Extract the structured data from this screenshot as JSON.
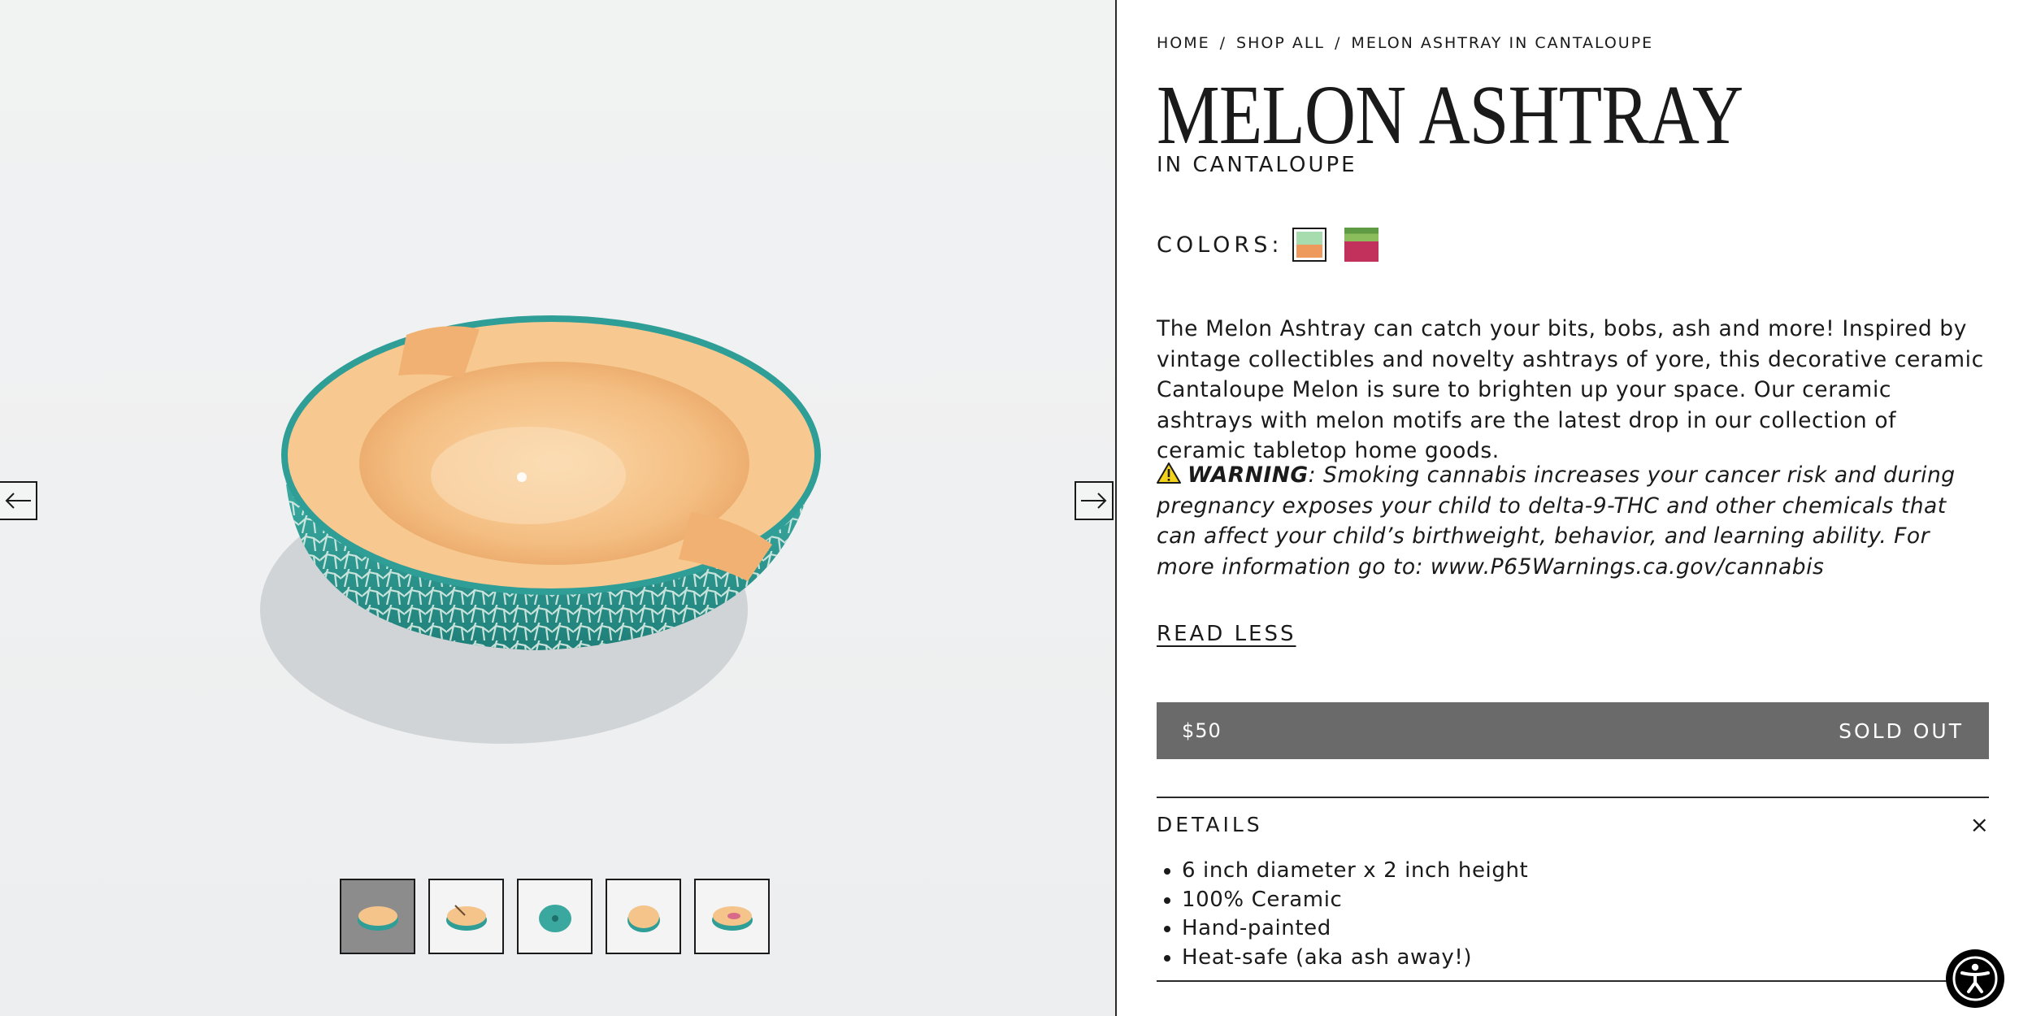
{
  "breadcrumb": {
    "home": "HOME",
    "shop_all": "SHOP ALL",
    "current": "MELON ASHTRAY IN CANTALOUPE",
    "separator": "/"
  },
  "product": {
    "title": "MELON ASHTRAY",
    "subtitle": "IN CANTALOUPE",
    "colors_label": "COLORS:",
    "colors": [
      {
        "name": "cantaloupe",
        "top": "#a6dcae",
        "bottom": "#ee9a5c",
        "selected": true
      },
      {
        "name": "watermelon",
        "top": "#6aa84f",
        "bottom": "#c2315b",
        "selected": false
      }
    ],
    "description": "The Melon Ashtray can catch your bits, bobs, ash and more! Inspired by vintage collectibles and novelty ashtrays of yore, this decorative ceramic Cantaloupe Melon is sure to brighten up your space. Our ceramic ashtrays with melon motifs are the latest drop in our collection of ceramic tabletop home goods.",
    "warning_label": "WARNING",
    "warning_text": ": Smoking cannabis increases your cancer risk and during pregnancy exposes your child to delta-9-THC and other chemicals that can affect your child’s birthweight, behavior, and learning ability. For more information go to: www.P65Warnings.ca.gov/cannabis",
    "read_less": "READ LESS",
    "price": "$50",
    "availability": "SOLD OUT",
    "details_label": "DETAILS",
    "details_close": "×",
    "details": [
      "6 inch diameter x 2 inch height",
      "100% Ceramic",
      "Hand-painted",
      "Heat-safe (aka ash away!)"
    ]
  },
  "gallery": {
    "thumbnail_count": 5,
    "active_index": 0,
    "icons": {
      "prev": "arrow-left-icon",
      "next": "arrow-right-icon",
      "accessibility": "accessibility-icon",
      "warning": "warning-icon"
    }
  },
  "colors": {
    "accent_bar": "#6a6a6a",
    "melon_rind": "#2f9e96",
    "melon_flesh": "#f5c48a"
  }
}
